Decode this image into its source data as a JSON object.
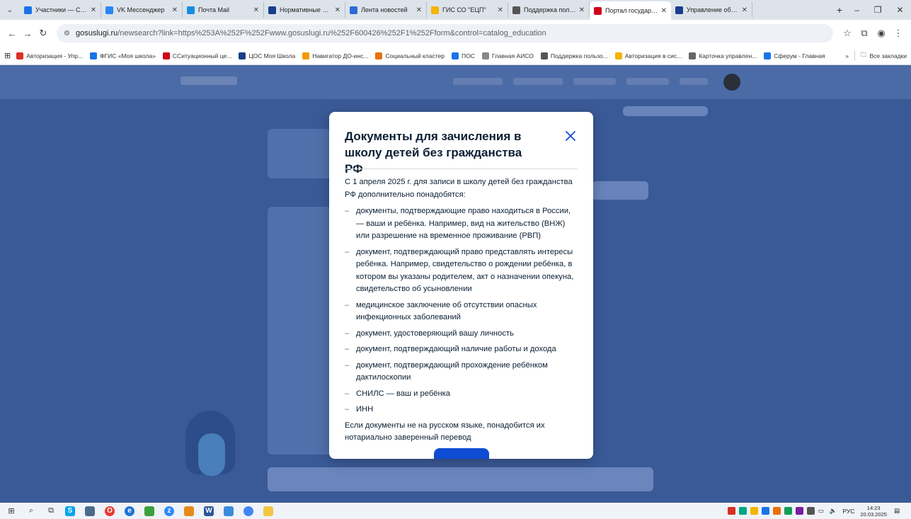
{
  "browser": {
    "tabs": [
      {
        "label": "Участники — Сферу",
        "color": "#1b73e8",
        "active": false
      },
      {
        "label": "VK Мессенджер",
        "color": "#2787f5",
        "active": false
      },
      {
        "label": "Почта Mail",
        "color": "#168de2",
        "active": false
      },
      {
        "label": "Нормативные доку",
        "color": "#1a3e8c",
        "active": false
      },
      {
        "label": "Лента новостей",
        "color": "#2b6ad7",
        "active": false
      },
      {
        "label": "ГИС СО \"ЕЦП\"",
        "color": "#f4b400",
        "active": false
      },
      {
        "label": "Поддержка пользо",
        "color": "#555555",
        "active": false
      },
      {
        "label": "Портал государств",
        "color": "#d0021b",
        "active": true
      },
      {
        "label": "Управление образо",
        "color": "#1b3d8f",
        "active": false
      }
    ],
    "new_tab": "+",
    "window_controls": {
      "minimize": "–",
      "restore": "❐",
      "close": "✕"
    },
    "address": {
      "host": "gosuslugi.ru",
      "rest": "/newsearch?link=https%253A%252F%252Fwww.gosuslugi.ru%252F600426%252F1%252Fform&control=catalog_education"
    },
    "bookmarks": [
      {
        "label": "Авторизация - Упр...",
        "color": "#d93025"
      },
      {
        "label": "ФГИС «Моя школа»",
        "color": "#1a73e8"
      },
      {
        "label": "ССитуационный це...",
        "color": "#d0021b"
      },
      {
        "label": "ЦОС Моя Школа",
        "color": "#1a3e8c"
      },
      {
        "label": "Навигатор ДО-инс...",
        "color": "#f29900"
      },
      {
        "label": "Социальный кластер",
        "color": "#e8710a"
      },
      {
        "label": "ПОС",
        "color": "#1a73e8"
      },
      {
        "label": "Главная АИСО",
        "color": "#888888"
      },
      {
        "label": "Поддержка пользо...",
        "color": "#555555"
      },
      {
        "label": "Авторизация в сис...",
        "color": "#f4b400"
      },
      {
        "label": "Карточка управлен...",
        "color": "#666666"
      },
      {
        "label": "Сферум - Главная",
        "color": "#1b73e8"
      }
    ],
    "bookmarks_more": "»",
    "all_bookmarks": "Все закладки"
  },
  "modal": {
    "title": "Документы для зачисления в школу детей без гражданства РФ",
    "intro": "С 1 апреля 2025 г. для записи в школу детей без гражданства РФ дополнительно понадобятся:",
    "items": [
      "документы, подтверждающие право находиться в России, — ваши и ребёнка. Например, вид на жительство (ВНЖ) или разрешение на временное проживание (РВП)",
      "документ, подтверждающий право представлять интересы ребёнка. Например, свидетельство о рождении ребёнка, в котором вы указаны родителем, акт о назначении опекуна, свидетельство об усыновлении",
      "медицинское заключение об отсутствии опасных инфекционных заболеваний",
      "документ, удостоверяющий вашу личность",
      "документ, подтверждающий наличие работы и дохода",
      "документ, подтверждающий прохождение ребёнком дактилоскопии",
      "СНИЛС — ваш и ребёнка",
      "ИНН"
    ],
    "bullet": "–",
    "outro": "Если документы не на русском языке, понадобится их нотариально заверенный перевод",
    "accent": "#0d4cd3"
  },
  "taskbar": {
    "language": "РУС",
    "time": "14:23",
    "date": "20.03.2025"
  }
}
